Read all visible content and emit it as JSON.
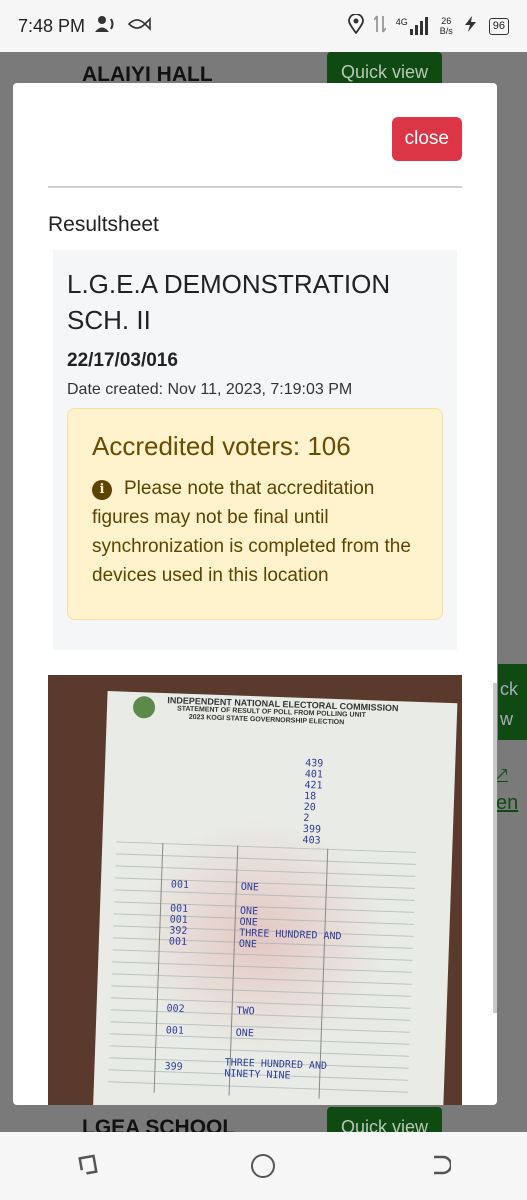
{
  "status_bar": {
    "time": "7:48 PM",
    "network_type": "4G",
    "speed_value": "26",
    "speed_unit": "B/s",
    "battery": "96",
    "icons": [
      "person-icon",
      "fish-icon",
      "location-icon",
      "data-arrows-icon",
      "signal-icon",
      "charging-icon"
    ]
  },
  "background_page": {
    "rows": [
      {
        "title": "ALAIYI HALL",
        "button": "Quick view"
      },
      {
        "title": "LGEA SCHOOL",
        "button": "Quick view"
      },
      {
        "title": "LGEA SCHOOL",
        "button": "Quick view"
      }
    ],
    "side_button": "ck\nw",
    "side_link": "en"
  },
  "modal": {
    "close_label": "close",
    "section_title": "Resultsheet",
    "polling_unit": {
      "name": "L.G.E.A DEMONSTRATION SCH. II",
      "code": "22/17/03/016",
      "date_created": "Date created: Nov 11, 2023, 7:19:03 PM"
    },
    "alert": {
      "title": "Accredited voters: 106",
      "message": "Please note that accreditation figures may not be final until synchronization is completed from the devices used in this location"
    },
    "result_image": {
      "header_line_1": "INDEPENDENT NATIONAL ELECTORAL COMMISSION",
      "header_line_2": "STATEMENT OF RESULT OF POLL FROM POLLING UNIT",
      "header_line_3": "2023 KOGI STATE GOVERNORSHIP ELECTION"
    }
  },
  "nav_bar": {
    "icons": [
      "recents-icon",
      "home-icon",
      "back-icon"
    ]
  }
}
